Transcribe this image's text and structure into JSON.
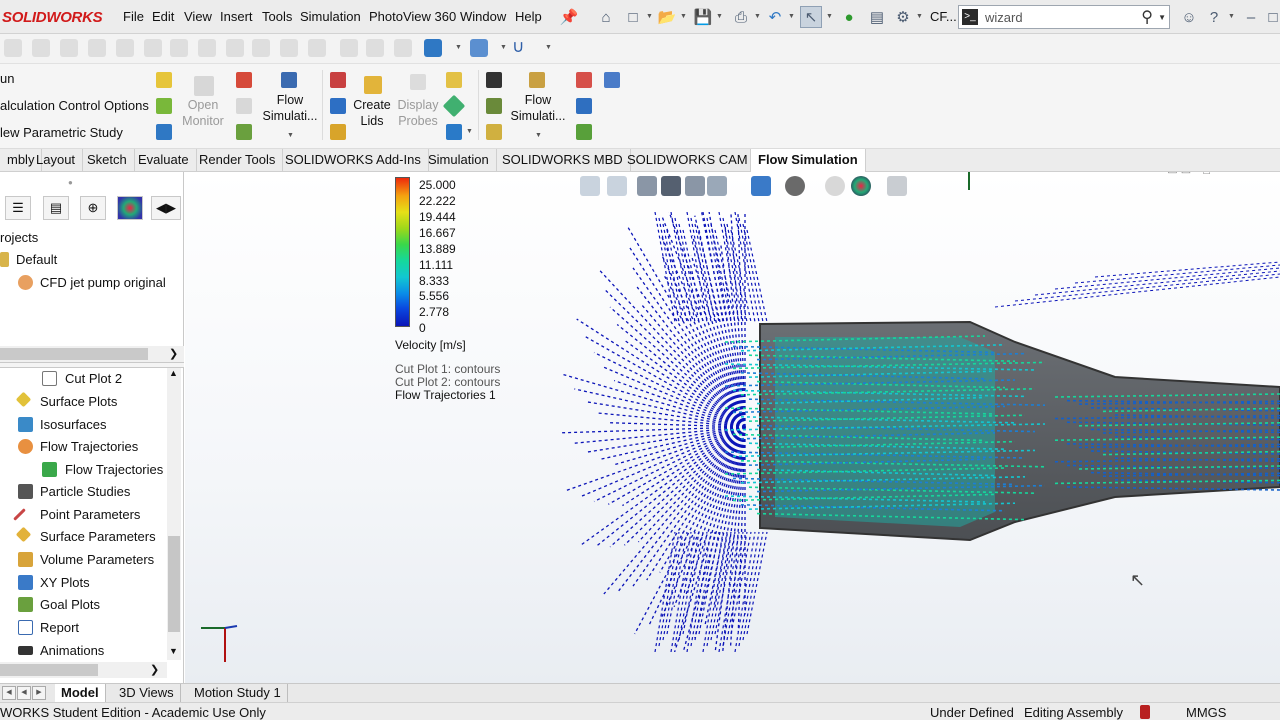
{
  "app": {
    "logo": "SOLIDWORKS"
  },
  "menu": [
    "File",
    "Edit",
    "View",
    "Insert",
    "Tools",
    "Simulation",
    "PhotoView 360",
    "Window",
    "Help"
  ],
  "quick_access": {
    "doc_label": "CF..."
  },
  "search": {
    "value": "wizard"
  },
  "ribbon": {
    "left_items": [
      "un",
      "alculation Control Options",
      "lew Parametric Study"
    ],
    "open_monitor": "Open Monitor",
    "flow_sim_1": "Flow Simulati...",
    "create_lids": "Create Lids",
    "display_probes": "Display Probes",
    "flow_sim_2": "Flow Simulati..."
  },
  "tabs": [
    "mbly",
    "Layout",
    "Sketch",
    "Evaluate",
    "Render Tools",
    "SOLIDWORKS Add-Ins",
    "Simulation",
    "SOLIDWORKS MBD",
    "SOLIDWORKS CAM",
    "Flow Simulation"
  ],
  "active_tab": "Flow Simulation",
  "tree_top": {
    "projects": "rojects",
    "default": "Default",
    "project_name": "CFD jet pump original"
  },
  "tree_bottom": [
    "Cut Plot 2",
    "Surface Plots",
    "Isosurfaces",
    "Flow Trajectories",
    "Flow Trajectories 1",
    "Particle Studies",
    "Point Parameters",
    "Surface Parameters",
    "Volume Parameters",
    "XY Plots",
    "Goal Plots",
    "Report",
    "Animations"
  ],
  "legend": {
    "values": [
      "25.000",
      "22.222",
      "19.444",
      "16.667",
      "13.889",
      "11.111",
      "8.333",
      "5.556",
      "2.778",
      "0"
    ],
    "title": "Velocity [m/s]",
    "plots": [
      "Cut Plot 1: contours",
      "Cut Plot 2: contours",
      "Flow Trajectories 1"
    ]
  },
  "bottom_tabs": [
    "Model",
    "3D Views",
    "Motion Study 1"
  ],
  "status": {
    "left": "WORKS Student Edition - Academic Use Only",
    "state": "Under Defined",
    "mode": "Editing Assembly",
    "units": "MMGS"
  },
  "colors": {
    "accent": "#d11a1a",
    "flow_blue": "#0b14b8",
    "flow_teal": "#15d89c"
  }
}
